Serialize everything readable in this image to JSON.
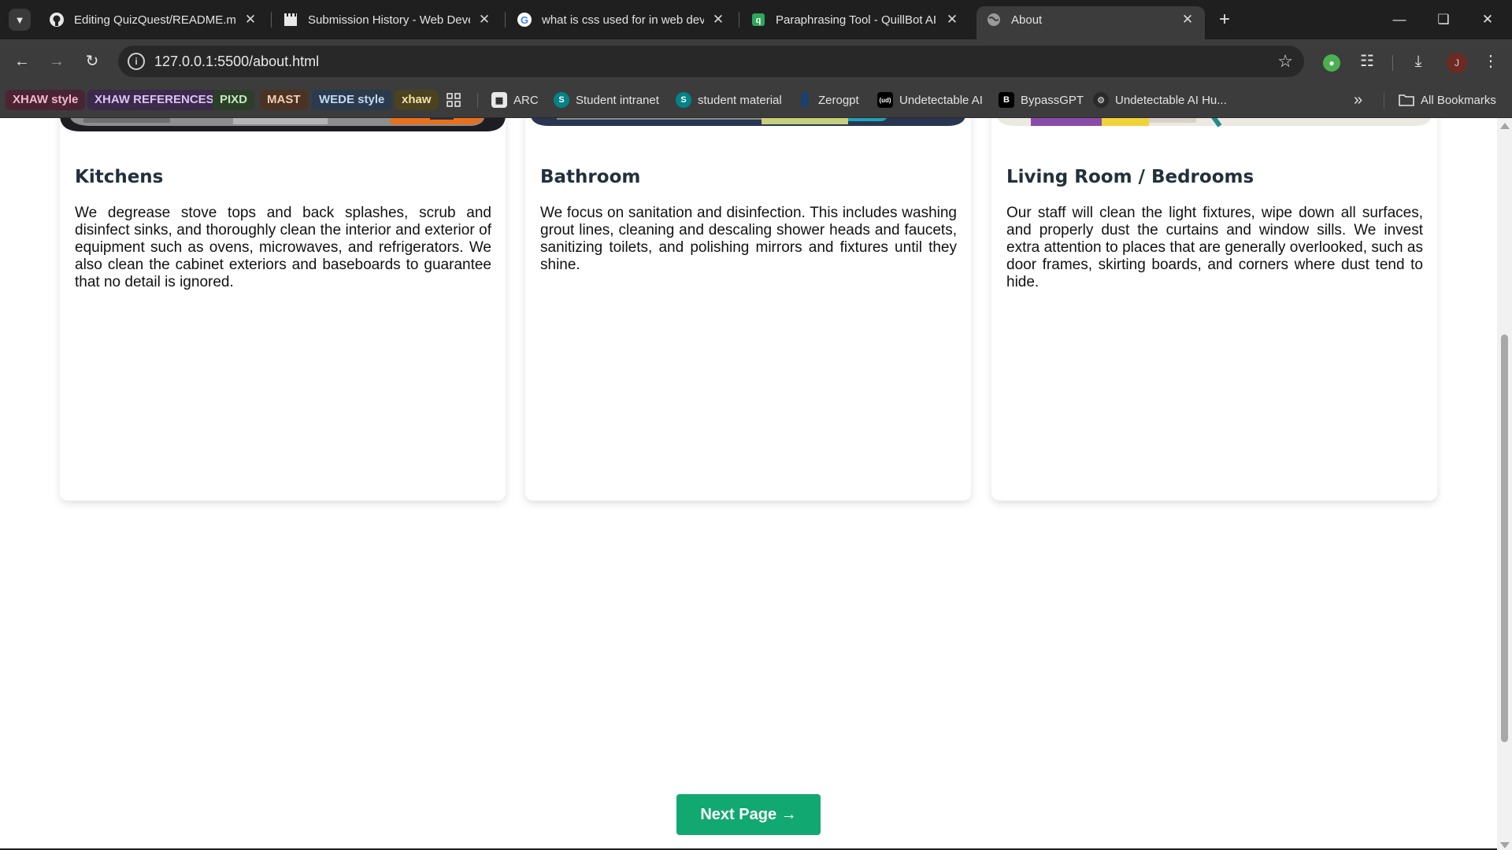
{
  "browser": {
    "tabs": [
      {
        "title": "Editing QuizQuest/README.md",
        "icon": "github-icon"
      },
      {
        "title": "Submission History - Web Deve",
        "icon": "clapperboard-icon"
      },
      {
        "title": "what is css used for in web deve",
        "icon": "google-icon"
      },
      {
        "title": "Paraphrasing Tool - QuillBot AI",
        "icon": "quillbot-icon"
      },
      {
        "title": "About",
        "icon": "globe-icon"
      }
    ],
    "active_tab": 4,
    "url": "127.0.0.1:5500/about.html",
    "profile_initial": "J",
    "bookmarks": {
      "chips": [
        {
          "label": "XHAW style",
          "bg": "#4a2433",
          "fg": "#f2b8cc"
        },
        {
          "label": "XHAW REFERENCES",
          "bg": "#3b2a4a",
          "fg": "#dcc3f5"
        },
        {
          "label": "PIXD",
          "bg": "#2c3e2a",
          "fg": "#c5e8bd"
        },
        {
          "label": "MAST",
          "bg": "#4a3324",
          "fg": "#f3cdb2"
        },
        {
          "label": "WEDE style",
          "bg": "#2b3a4c",
          "fg": "#c2d8f2"
        },
        {
          "label": "xhaw",
          "bg": "#4a4220",
          "fg": "#f2e3a6"
        }
      ],
      "links": [
        {
          "label": "ARC"
        },
        {
          "label": "Student intranet"
        },
        {
          "label": "student material"
        },
        {
          "label": "Zerogpt"
        },
        {
          "label": "Undetectable AI"
        },
        {
          "label": "BypassGPT"
        },
        {
          "label": "Undetectable AI Hu..."
        }
      ],
      "all_bookmarks": "All Bookmarks"
    }
  },
  "page": {
    "cards": [
      {
        "title": "Kitchens",
        "text": "We degrease stove tops and back splashes, scrub and disinfect sinks, and thoroughly clean the interior and exterior of equipment such as ovens, microwaves, and refrigerators. We also clean the cabinet exteriors and baseboards to guarantee that no detail is ignored."
      },
      {
        "title": "Bathroom",
        "text": "We focus on sanitation and disinfection. This includes washing grout lines, cleaning and descaling shower heads and faucets, sanitizing toilets, and polishing mirrors and fixtures until they shine."
      },
      {
        "title": "Living Room / Bedrooms",
        "text": "Our staff will clean the light fixtures, wipe down all surfaces, and properly dust the curtains and window sills. We invest extra attention to places that are generally overlooked, such as door frames, skirting boards, and corners where dust tend to hide."
      }
    ],
    "next_button": "Next Page →",
    "accent_color": "#12a871"
  }
}
